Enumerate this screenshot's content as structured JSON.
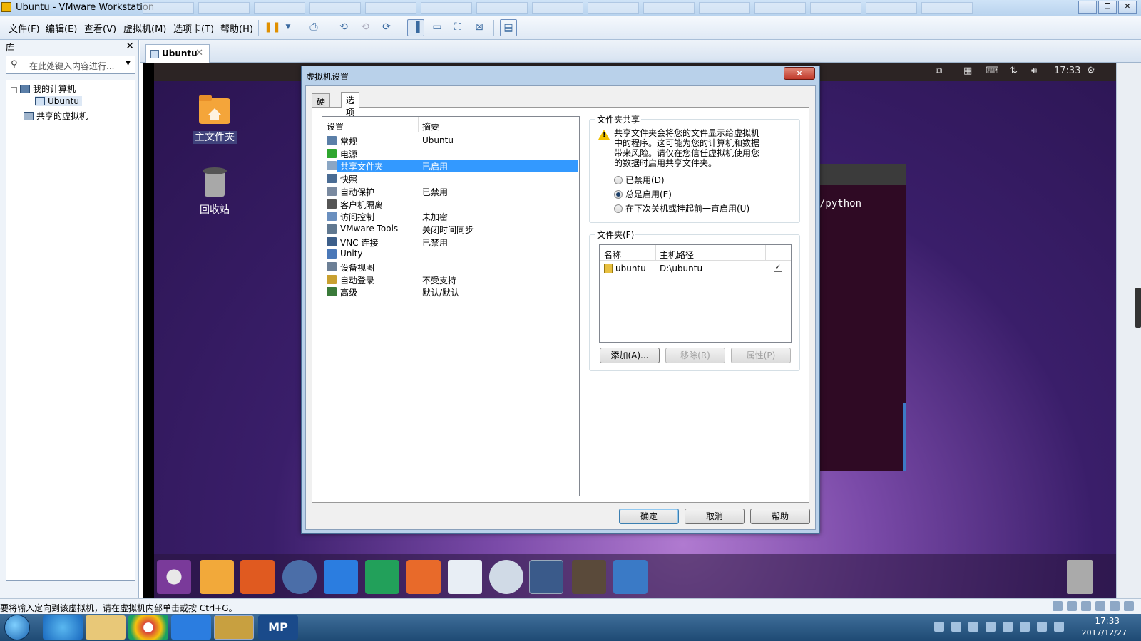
{
  "window": {
    "title": "Ubuntu - VMware Workstation"
  },
  "menu": {
    "items": [
      "文件(F)",
      "编辑(E)",
      "查看(V)",
      "虚拟机(M)",
      "选项卡(T)",
      "帮助(H)"
    ]
  },
  "library": {
    "title": "库",
    "search_placeholder": "在此处键入内容进行...",
    "tree": {
      "my_computer": "我的计算机",
      "vm": "Ubuntu",
      "shared": "共享的虚拟机"
    }
  },
  "vm_tab": {
    "label": "Ubuntu"
  },
  "guest": {
    "clock": "17:33",
    "desktop_icons": {
      "home": "主文件夹",
      "trash": "回收站"
    },
    "terminal_text": "/python"
  },
  "dialog": {
    "title": "虚拟机设置",
    "tabs": [
      "硬件",
      "选项"
    ],
    "settings_list": {
      "col_setting": "设置",
      "col_summary": "摘要",
      "rows": [
        {
          "name": "常规",
          "summary": "Ubuntu",
          "icon": "monitor-icon",
          "color": "#5b7fa8"
        },
        {
          "name": "电源",
          "summary": "",
          "icon": "power-play-icon",
          "color": "#2fa62f"
        },
        {
          "name": "共享文件夹",
          "summary": "已启用",
          "icon": "shared-folder-icon",
          "color": "#8aa6c4"
        },
        {
          "name": "快照",
          "summary": "",
          "icon": "snapshot-icon",
          "color": "#4a6c94"
        },
        {
          "name": "自动保护",
          "summary": "已禁用",
          "icon": "autoprotect-icon",
          "color": "#7a8aa0"
        },
        {
          "name": "客户机隔离",
          "summary": "",
          "icon": "lock-icon",
          "color": "#555555"
        },
        {
          "name": "访问控制",
          "summary": "未加密",
          "icon": "access-control-icon",
          "color": "#6a8fbf"
        },
        {
          "name": "VMware Tools",
          "summary": "关闭时间同步",
          "icon": "vmware-tools-icon",
          "color": "#607890"
        },
        {
          "name": "VNC 连接",
          "summary": "已禁用",
          "icon": "vnc-icon",
          "color": "#3d5f8a"
        },
        {
          "name": "Unity",
          "summary": "",
          "icon": "unity-icon",
          "color": "#4a78b8"
        },
        {
          "name": "设备视图",
          "summary": "",
          "icon": "device-view-icon",
          "color": "#6c7f96"
        },
        {
          "name": "自动登录",
          "summary": "不受支持",
          "icon": "auto-login-icon",
          "color": "#c8a030"
        },
        {
          "name": "高级",
          "summary": "默认/默认",
          "icon": "advanced-icon",
          "color": "#3a7a3a"
        }
      ],
      "selected_index": 2
    },
    "sharing": {
      "group_title": "文件夹共享",
      "warning": "共享文件夹会将您的文件显示给虚拟机中的程序。这可能为您的计算机和数据带来风险。请仅在您信任虚拟机使用您的数据时启用共享文件夹。",
      "options": [
        "已禁用(D)",
        "总是启用(E)",
        "在下次关机或挂起前一直启用(U)"
      ],
      "selected_option": 1
    },
    "folders": {
      "group_title": "文件夹(F)",
      "col_name": "名称",
      "col_path": "主机路径",
      "rows": [
        {
          "name": "ubuntu",
          "path": "D:\\ubuntu",
          "checked_mark": "✓"
        }
      ],
      "add_label": "添加(A)...",
      "remove_label": "移除(R)",
      "props_label": "属性(P)"
    },
    "buttons": {
      "ok": "确定",
      "cancel": "取消",
      "help": "帮助"
    }
  },
  "statusbar": {
    "message": "要将输入定向到该虚拟机，请在虚拟机内部单击或按 Ctrl+G。"
  },
  "taskbar": {
    "time": "17:33",
    "date": "2017/12/27",
    "mp_label": "MP"
  }
}
